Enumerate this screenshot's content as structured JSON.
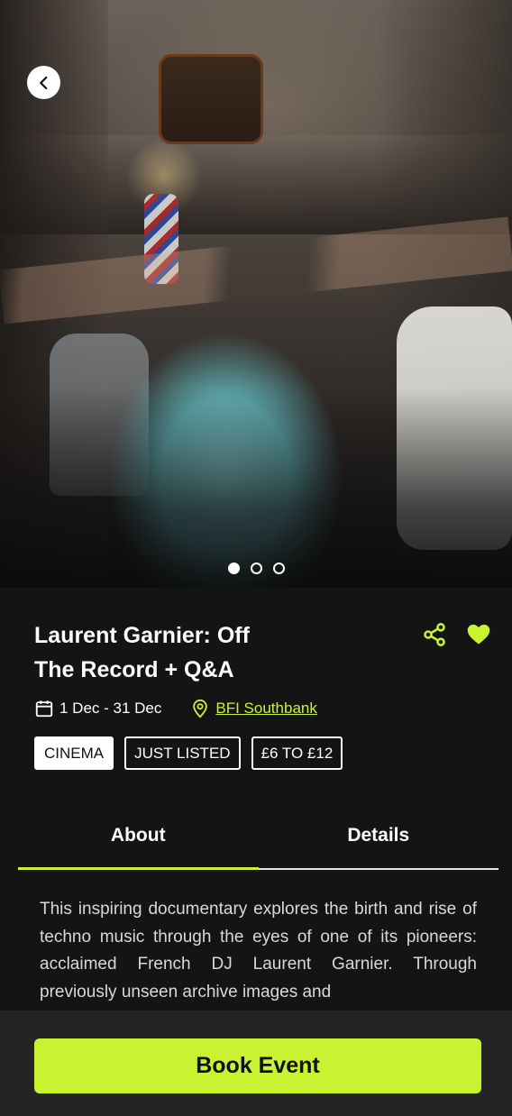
{
  "hero": {
    "image_alt": "Dancers performing in the street",
    "carousel": {
      "total": 3,
      "active_index": 0
    }
  },
  "event": {
    "title_line1": "Laurent Garnier: Off",
    "title_line2": "The Record + Q&A",
    "date": "1 Dec - 31 Dec",
    "venue": "BFI Southbank",
    "tags": [
      "CINEMA",
      "JUST LISTED",
      "£6 TO £12"
    ],
    "favorited": true
  },
  "tabs": [
    {
      "label": "About",
      "active": true
    },
    {
      "label": "Details",
      "active": false
    }
  ],
  "about": {
    "text": "This inspiring documentary explores the birth and rise of techno music through the eyes of one of its pioneers: acclaimed French DJ Laurent Garnier. Through previously unseen archive images and"
  },
  "cta": {
    "label": "Book Event"
  },
  "colors": {
    "accent": "#c9f230",
    "background": "#141414",
    "bottom_bar": "#242424"
  },
  "icons": [
    "chevron-left-icon",
    "share-icon",
    "heart-icon",
    "calendar-icon",
    "location-pin-icon"
  ]
}
